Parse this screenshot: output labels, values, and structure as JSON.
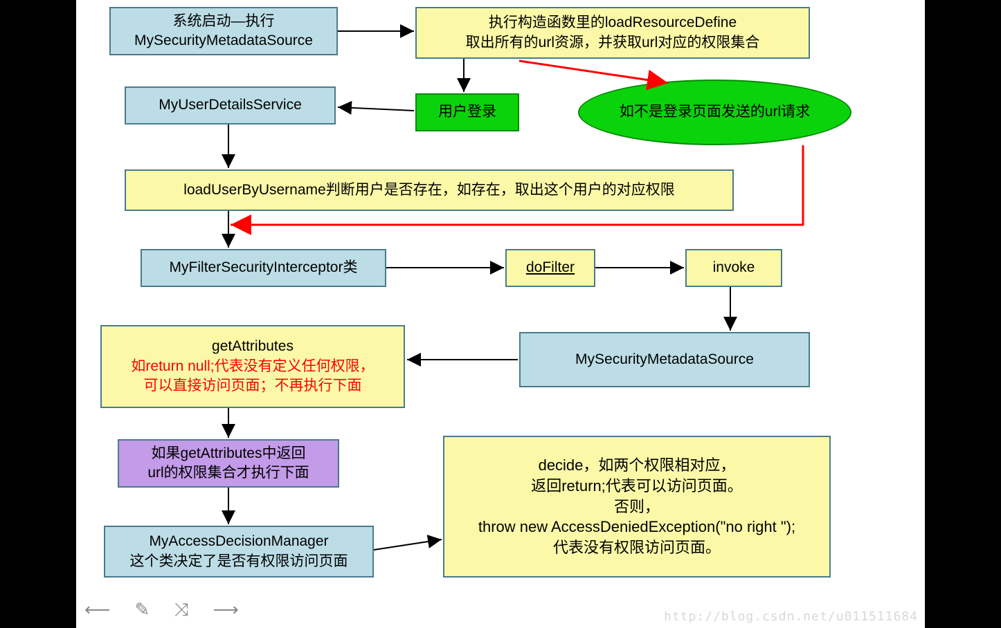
{
  "n1_l1": "系统启动—执行",
  "n1_l2": "MySecurityMetadataSource",
  "n2_l1": "执行构造函数里的loadResourceDefine",
  "n2_l2": "取出所有的url资源，并获取url对应的权限集合",
  "n3": "MyUserDetailsService",
  "n4": "用户登录",
  "n5": "如不是登录页面发送的url请求",
  "n6": "loadUserByUsername判断用户是否存在，如存在，取出这个用户的对应权限",
  "n7": "MyFilterSecurityInterceptor类",
  "n8": "doFilter",
  "n9": "invoke",
  "n10": "MySecurityMetadataSource",
  "n11_l1": "getAttributes",
  "n11_l2": "如return null;代表没有定义任何权限，",
  "n11_l3": "可以直接访问页面；不再执行下面",
  "n12_l1": "如果getAttributes中返回",
  "n12_l2": "url的权限集合才执行下面",
  "n13_l1": "MyAccessDecisionManager",
  "n13_l2": "这个类决定了是否有权限访问页面",
  "n14_l1": "decide，如两个权限相对应，",
  "n14_l2": "返回return;代表可以访问页面。",
  "n14_l3": "否则，",
  "n14_l4": "throw new AccessDeniedException(\"no right \");",
  "n14_l5": "代表没有权限访问页面。",
  "watermark": "http://blog.csdn.net/u011511684"
}
